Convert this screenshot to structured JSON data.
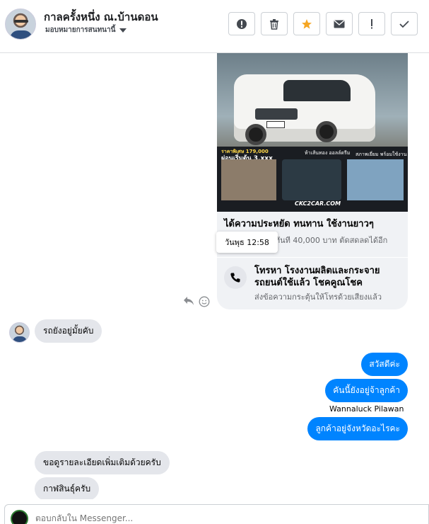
{
  "header": {
    "title": "กาลครั้งหนึ่ง ณ.บ้านดอน",
    "subtitle": "มอบหมายการสนทนานี้",
    "actions": [
      {
        "name": "mark-spam-button",
        "icon": "alert-circle-icon",
        "glyph": "!"
      },
      {
        "name": "delete-button",
        "icon": "trash-icon",
        "glyph": "🗑"
      },
      {
        "name": "star-button",
        "icon": "star-icon",
        "glyph": "★"
      },
      {
        "name": "mark-unread-button",
        "icon": "envelope-icon",
        "glyph": "✉"
      },
      {
        "name": "follow-up-button",
        "icon": "exclamation-icon",
        "glyph": "!"
      },
      {
        "name": "mark-done-button",
        "icon": "check-icon",
        "glyph": "✓"
      }
    ]
  },
  "ad_card": {
    "image_price_label": "ราคาพิเศษ 179,000",
    "image_down_payment": "ผ่อนเริ่มต้น 3,xxx",
    "image_middle_caption": "ห้าเส้นทอง ออลล์ดรีม",
    "image_right_caption": "สภาพเยี่ยม พร้อมใช้งาน",
    "image_brand": "CKC2CAR.COM",
    "title": "ได้ความประหยัด ทนทาน ใช้งานยาวๆ",
    "description": "ลดทันที 40,000 บาท ตัดสดลดได้อีก"
  },
  "timestamp_tooltip": "วันพุธ 12:58",
  "call_card": {
    "title": "โทรหา โรงงานผลิตและกระจายรถยนต์ใช้แล้ว โชคคูณโชค",
    "subtitle": "ส่งข้อความกระตุ้นให้โทรด้วยเสียงแล้ว"
  },
  "messages": {
    "incoming_1": "รถยังอยู่มั้ยคับ",
    "outgoing_1": "สวัสดีค่ะ",
    "outgoing_2": "คันนี้ยังอยู่จ้าลูกค้า",
    "sender_name": "Wannaluck Pilawan",
    "outgoing_3": "ลูกค้าอยู่จังหวัดอะไรคะ",
    "incoming_2": "ขอดูรายละเอียดเพิ่มเติมด้วยครับ",
    "incoming_3": "กาฬสินธุ์ครับ"
  },
  "composer": {
    "placeholder": "ตอบกลับใน Messenger..."
  },
  "colors": {
    "outgoing_bubble": "#0084ff",
    "incoming_bubble": "#e4e6eb",
    "star_accent": "#f5a623"
  }
}
